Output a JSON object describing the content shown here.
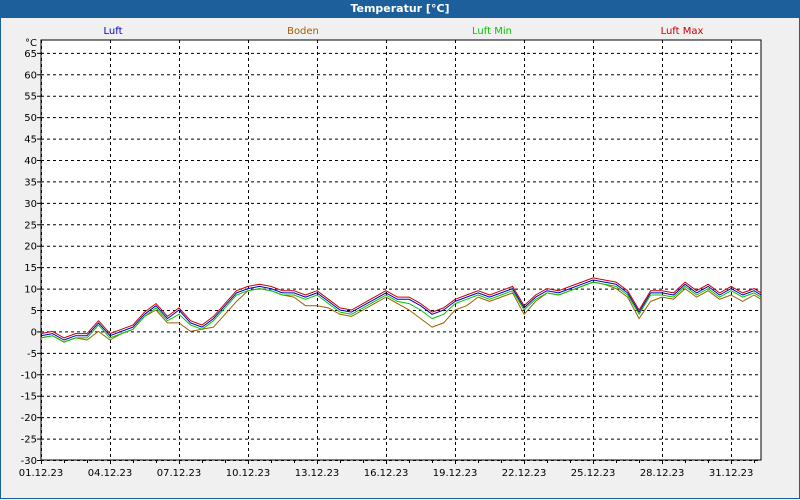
{
  "window": {
    "title": "Temperatur [°C]"
  },
  "colors": {
    "title_bar": "#1c5f9a",
    "background": "#f0f0f0",
    "plot_area": "#ffffff",
    "grid": "#000000"
  },
  "chart_data": {
    "type": "line",
    "title": "",
    "xlabel": "",
    "ylabel": "°C",
    "ylim": [
      -30,
      68
    ],
    "yticks": [
      65,
      60,
      55,
      50,
      45,
      40,
      35,
      30,
      25,
      20,
      15,
      10,
      5,
      0,
      -5,
      -10,
      -15,
      -20,
      -25,
      -30
    ],
    "xlim": [
      0,
      31.3
    ],
    "xtick_positions": [
      0,
      3,
      6,
      9,
      12,
      15,
      18,
      21,
      24,
      27,
      30
    ],
    "xticks": [
      "01.12.23",
      "04.12.23",
      "07.12.23",
      "10.12.23",
      "13.12.23",
      "16.12.23",
      "19.12.23",
      "22.12.23",
      "25.12.23",
      "28.12.23",
      "31.12.23"
    ],
    "grid": true,
    "legend_position": "top",
    "x": [
      0,
      0.5,
      1,
      1.5,
      2,
      2.5,
      3,
      3.5,
      4,
      4.5,
      5,
      5.5,
      6,
      6.5,
      7,
      7.5,
      8,
      8.5,
      9,
      9.5,
      10,
      10.5,
      11,
      11.5,
      12,
      12.5,
      13,
      13.5,
      14,
      14.5,
      15,
      15.5,
      16,
      16.5,
      17,
      17.5,
      18,
      18.5,
      19,
      19.5,
      20,
      20.5,
      21,
      21.5,
      22,
      22.5,
      23,
      23.5,
      24,
      24.5,
      25,
      25.5,
      26,
      26.5,
      27,
      27.5,
      28,
      28.5,
      29,
      29.5,
      30,
      30.5,
      31,
      31.3
    ],
    "series": [
      {
        "name": "Luft",
        "color": "#0000c8",
        "values": [
          -1,
          -0.5,
          -2,
          -1,
          -1,
          2,
          -1,
          0,
          1,
          4,
          6,
          3,
          5,
          2,
          1,
          3,
          6,
          9,
          10,
          10.5,
          10,
          9,
          9,
          8,
          9,
          7,
          5,
          4.5,
          6,
          7.5,
          9,
          7.5,
          7.5,
          6,
          4,
          5,
          7,
          8,
          9,
          8,
          9,
          10,
          5.5,
          8,
          9.5,
          9,
          10,
          11,
          12,
          11.5,
          11,
          9,
          4.5,
          9,
          9,
          8.5,
          11,
          9,
          10.5,
          8.5,
          10,
          8.5,
          9.5,
          8.5
        ]
      },
      {
        "name": "Boden",
        "color": "#a06000",
        "values": [
          -1.5,
          -1,
          -2.5,
          -1.5,
          -2,
          0,
          -2,
          -0.5,
          0.5,
          3.5,
          5,
          2,
          2,
          0,
          0.5,
          1,
          4,
          7,
          9.5,
          10,
          9.5,
          8.5,
          8,
          6,
          6,
          5.5,
          4,
          3.5,
          5,
          6.5,
          8,
          6.5,
          5,
          3,
          1,
          2,
          5,
          6,
          8,
          7,
          8,
          9,
          4,
          7,
          9,
          8.5,
          9.5,
          10.5,
          11.5,
          11,
          10,
          8,
          3,
          7,
          8,
          7.5,
          10,
          8,
          9.5,
          7.5,
          8.5,
          7,
          8.5,
          7.5
        ]
      },
      {
        "name": "Luft Min",
        "color": "#00c800",
        "values": [
          -1.5,
          -1,
          -2.5,
          -1.5,
          -1.5,
          1.5,
          -1.5,
          -0.5,
          0.5,
          3.5,
          5.5,
          2.5,
          4,
          1.5,
          0.5,
          2.5,
          5.5,
          8.5,
          9.5,
          10,
          9.5,
          8.5,
          8.5,
          7.5,
          8.5,
          6.5,
          4.5,
          4,
          5.5,
          7,
          8.5,
          7,
          6.5,
          5,
          3,
          4,
          6.5,
          7.5,
          8.5,
          7.5,
          8.5,
          9.5,
          5,
          7.5,
          9,
          8.5,
          9.5,
          10.5,
          11.5,
          11,
          10.5,
          8.5,
          4,
          8.5,
          8.5,
          8,
          10.5,
          8.5,
          10,
          8,
          9.5,
          8,
          9,
          8
        ]
      },
      {
        "name": "Luft Max",
        "color": "#c80000",
        "values": [
          -0.5,
          0,
          -1.5,
          -0.5,
          -0.5,
          2.5,
          -0.5,
          0.5,
          1.5,
          4.5,
          6.5,
          3.5,
          5.5,
          2.5,
          1.5,
          3.5,
          6.5,
          9.5,
          10.5,
          11,
          10.5,
          9.5,
          9.5,
          8.5,
          9.5,
          7.5,
          5.5,
          5,
          6.5,
          8,
          9.5,
          8,
          8,
          6.5,
          4.5,
          5.5,
          7.5,
          8.5,
          9.5,
          8.5,
          9.5,
          10.5,
          6,
          8.5,
          10,
          9.5,
          10.5,
          11.5,
          12.5,
          12,
          11.5,
          9.5,
          5,
          9.5,
          9.5,
          9,
          11.5,
          9.5,
          11,
          9,
          10.5,
          9,
          10,
          9
        ]
      }
    ]
  }
}
